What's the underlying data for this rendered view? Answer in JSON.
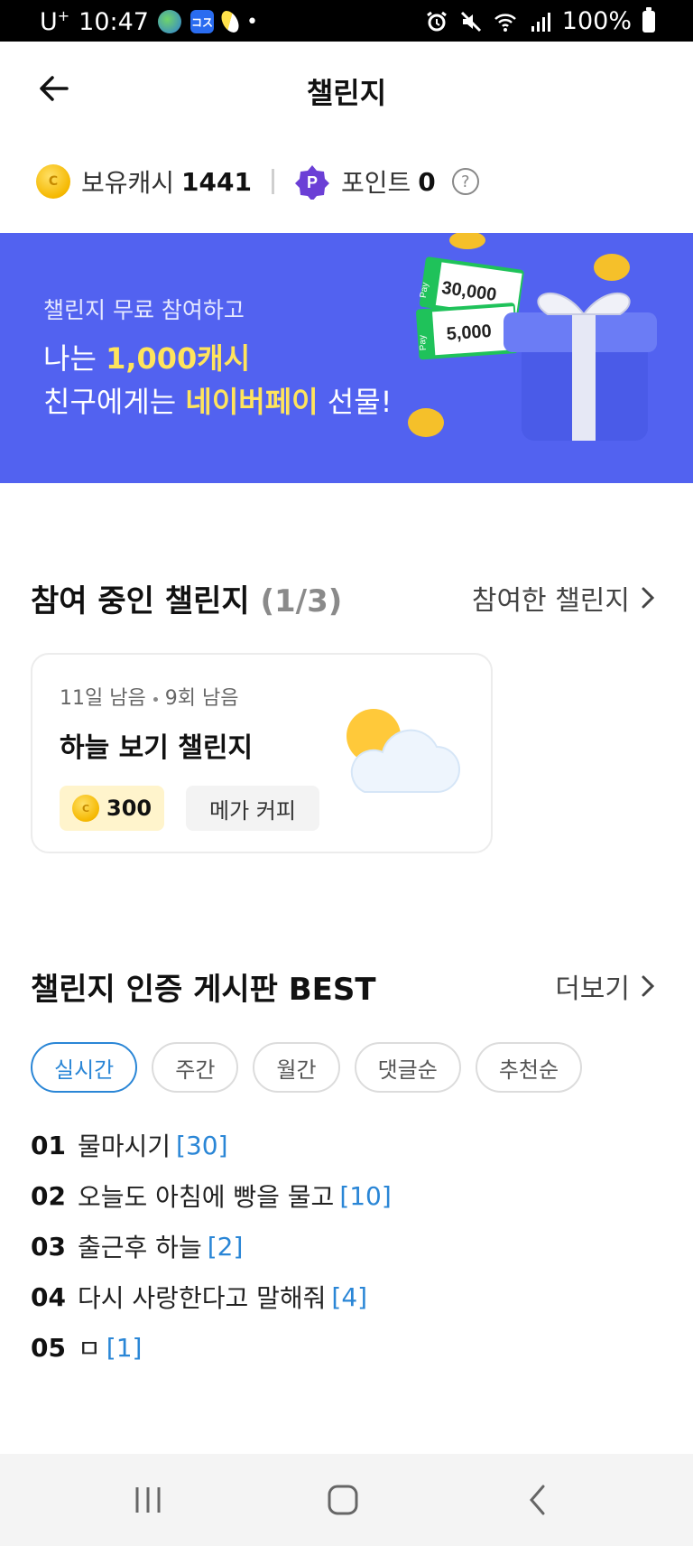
{
  "status_bar": {
    "carrier": "U",
    "carrier_sup": "+",
    "time": "10:47",
    "app_icon_kr": "コス",
    "battery": "100%"
  },
  "app_bar": {
    "title": "챌린지",
    "back_icon": "arrow-left-icon"
  },
  "balance": {
    "cash_label": "보유캐시",
    "cash_value": "1441",
    "point_label": "포인트",
    "point_value": "0",
    "help_icon": "?"
  },
  "banner": {
    "subtitle": "챌린지 무료 참여하고",
    "line2_prefix": "나는 ",
    "line2_highlight": "1,000캐시",
    "line3_prefix": "친구에게는 ",
    "line3_highlight": "네이버페이",
    "line3_suffix": " 선물!",
    "voucher1": "30,000",
    "voucher2": "5,000",
    "pay_label": "Pay",
    "background_color": "#5262f0",
    "highlight_color": "#ffe45c"
  },
  "active_section": {
    "title": "참여 중인 챌린지",
    "count": "(1/3)",
    "link_label": "참여한 챌린지"
  },
  "challenge_card": {
    "days_left": "11일 남음",
    "times_left": "9회 남음",
    "name": "하늘 보기 챌린지",
    "reward": "300",
    "prize": "메가 커피"
  },
  "best_section": {
    "title": "챌린지 인증 게시판 BEST",
    "link_label": "더보기",
    "filters": [
      "실시간",
      "주간",
      "월간",
      "댓글순",
      "추천순"
    ],
    "active_filter": "실시간",
    "items": [
      {
        "rank": "01",
        "title": "물마시기",
        "count": "[30]"
      },
      {
        "rank": "02",
        "title": "오늘도 아침에 빵을 물고",
        "count": "[10]"
      },
      {
        "rank": "03",
        "title": "출근후 하늘",
        "count": "[2]"
      },
      {
        "rank": "04",
        "title": "다시 사랑한다고 말해줘",
        "count": "[4]"
      },
      {
        "rank": "05",
        "title": "ㅁ",
        "count": "[1]"
      }
    ]
  },
  "accent_color": "#2a86d6"
}
